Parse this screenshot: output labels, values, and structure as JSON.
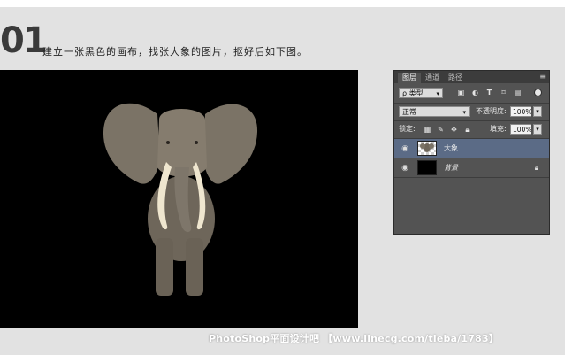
{
  "step": {
    "number": "01",
    "instruction": "建立一张黑色的画布，找张大象的图片，抠好后如下图。"
  },
  "layers_panel": {
    "tabs": [
      "图层",
      "通道",
      "路径"
    ],
    "menu_icon": "panel-menu-icon",
    "filter": {
      "label": "ρ 类型",
      "icons": [
        "image-filter-icon",
        "adjustment-filter-icon",
        "type-filter-icon",
        "shape-filter-icon",
        "smart-object-filter-icon"
      ]
    },
    "blend_mode": "正常",
    "opacity_label": "不透明度:",
    "opacity_value": "100%",
    "lock_label": "锁定:",
    "lock_icons": [
      "lock-transparent-icon",
      "lock-paint-icon",
      "lock-move-icon",
      "lock-all-icon"
    ],
    "fill_label": "填充:",
    "fill_value": "100%",
    "layers": [
      {
        "name": "大象",
        "selected": true,
        "thumb": "elephant"
      },
      {
        "name": "背景",
        "selected": false,
        "thumb": "black",
        "locked": true
      }
    ]
  },
  "watermark": "PhotoShop平面设计吧 【www.linecg.com/tieba/1783】",
  "colors": {
    "page_bg": "#e2e2e2",
    "canvas_bg": "#000000",
    "panel_bg": "#535353",
    "selected_layer": "#5b6b86"
  }
}
